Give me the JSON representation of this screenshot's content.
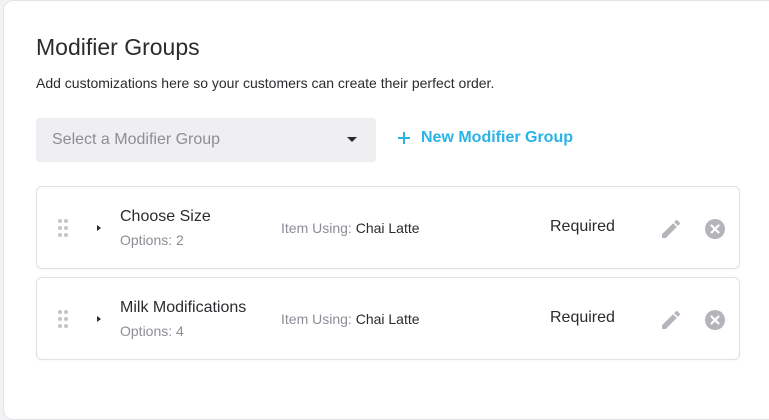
{
  "header": {
    "title": "Modifier Groups",
    "subtitle": "Add customizations here so your customers can create their perfect order."
  },
  "modifier_select": {
    "placeholder": "Select a Modifier Group",
    "icon": "caret-down-icon"
  },
  "new_group": {
    "label": "New Modifier Group",
    "icon": "plus-icon",
    "color": "#2ab3e6"
  },
  "groups": [
    {
      "name": "Choose Size",
      "options": "Options: 2",
      "item_using_label": "Item Using:",
      "item_using_value": "Chai Latte",
      "status": "Required"
    },
    {
      "name": "Milk Modifications",
      "options": "Options: 4",
      "item_using_label": "Item Using:",
      "item_using_value": "Chai Latte",
      "status": "Required"
    }
  ],
  "icons": {
    "drag": "drag-handle-icon",
    "expand": "caret-right-icon",
    "edit": "pencil-icon",
    "remove": "close-circle-icon"
  }
}
